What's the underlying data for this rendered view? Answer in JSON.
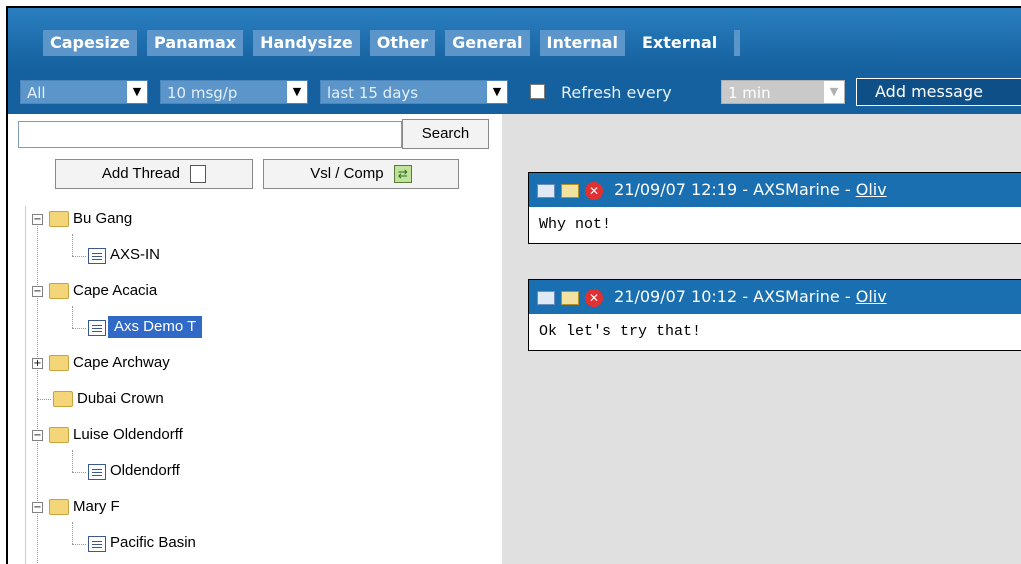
{
  "tabs": [
    "Capesize",
    "Panamax",
    "Handysize",
    "Other",
    "General",
    "Internal",
    "External"
  ],
  "toolbar": {
    "filter_value": "All",
    "msg_per_page_value": "10 msg/p",
    "period_value": "last 15 days",
    "refresh_label": "Refresh every",
    "refresh_interval_value": "1 min",
    "add_message_label": "Add message"
  },
  "search": {
    "button_label": "Search",
    "value": ""
  },
  "buttons": {
    "add_thread": "Add Thread",
    "vsl_comp": "Vsl / Comp"
  },
  "tree": [
    {
      "label": "Bu Gang"
    },
    {
      "label": "AXS-IN"
    },
    {
      "label": "Cape Acacia"
    },
    {
      "label": "Axs Demo T"
    },
    {
      "label": "Cape Archway"
    },
    {
      "label": "Dubai Crown"
    },
    {
      "label": "Luise Oldendorff"
    },
    {
      "label": "Oldendorff"
    },
    {
      "label": "Mary F"
    },
    {
      "label": "Pacific Basin"
    }
  ],
  "messages": [
    {
      "header": "21/09/07 12:19 - AXSMarine - ",
      "user": "Oliv",
      "body": "Why not!"
    },
    {
      "header": "21/09/07 10:12 - AXSMarine - ",
      "user": "Oliv",
      "body": "Ok let's try that!"
    }
  ],
  "colors": {
    "brand_blue": "#1a6fb0",
    "tab_bg": "#5b95c9",
    "selection": "#3169c6"
  }
}
